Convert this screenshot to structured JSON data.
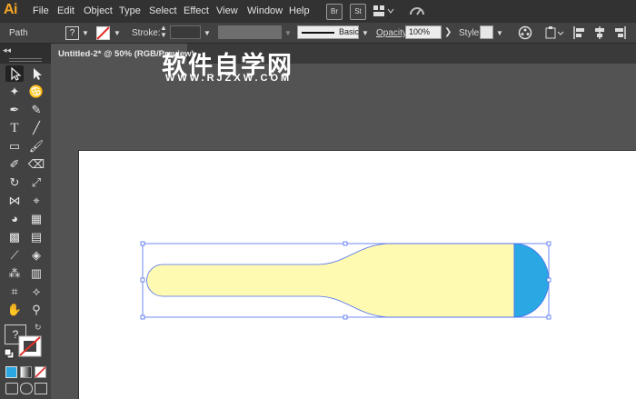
{
  "app": {
    "logo": "Ai"
  },
  "menu": [
    "File",
    "Edit",
    "Object",
    "Type",
    "Select",
    "Effect",
    "View",
    "Window",
    "Help"
  ],
  "top_icons": {
    "bridge": "Br",
    "stock": "St"
  },
  "control_bar": {
    "selection_label": "Path",
    "fill_label": "?",
    "stroke_label": "Stroke:",
    "brush_label": "Basic",
    "opacity_label": "Opacity:",
    "opacity_value": "100%",
    "style_label": "Style:"
  },
  "document": {
    "tab_title": "Untitled-2* @ 50% (RGB/Preview)"
  },
  "watermark": {
    "title": "软件自学网",
    "url": "WWW.RJZXW.COM"
  },
  "tools_panel": {
    "fill_stroke_label": "?"
  },
  "colors": {
    "shape_fill": "#fffab2",
    "shape_cap": "#29a8e3",
    "selection": "#4a6cf0",
    "canvas": "#535353",
    "artboard": "#ffffff"
  }
}
